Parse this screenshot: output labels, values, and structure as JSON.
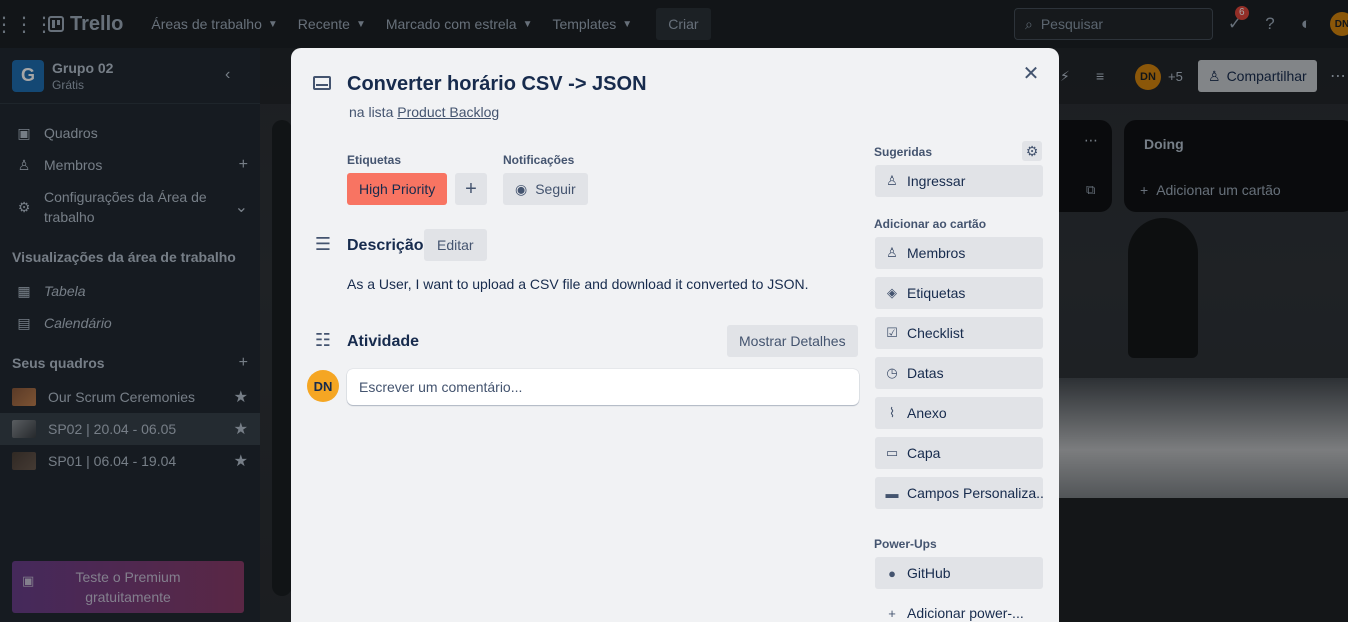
{
  "topbar": {
    "logo": "Trello",
    "nav": [
      "Áreas de trabalho",
      "Recente",
      "Marcado com estrela",
      "Templates"
    ],
    "create": "Criar",
    "search_placeholder": "Pesquisar",
    "notification_count": "6",
    "avatar": "DN"
  },
  "sidebar": {
    "workspace_initial": "G",
    "workspace_name": "Grupo 02",
    "workspace_plan": "Grátis",
    "items": [
      {
        "label": "Quadros",
        "icon": "trello-icon"
      },
      {
        "label": "Membros",
        "icon": "user-icon"
      },
      {
        "label": "Configurações da Área de trabalho",
        "icon": "gear-icon"
      }
    ],
    "views_title": "Visualizações da área de trabalho",
    "views": [
      {
        "label": "Tabela",
        "icon": "table-icon"
      },
      {
        "label": "Calendário",
        "icon": "calendar-icon"
      }
    ],
    "boards_title": "Seus quadros",
    "boards": [
      {
        "label": "Our Scrum Ceremonies",
        "color": "#8b5a3c"
      },
      {
        "label": "SP02 | 20.04 - 06.05",
        "color": "#5a6068"
      },
      {
        "label": "SP01 | 06.04 - 19.04",
        "color": "#4a4038"
      }
    ],
    "premium": "Teste o Premium gratuitamente"
  },
  "board": {
    "avatar": "DN",
    "extra_members": "+5",
    "share": "Compartilhar",
    "list_title": "Doing",
    "add_card": "Adicionar um cartão"
  },
  "card": {
    "title": "Converter horário CSV -> JSON",
    "in_list_prefix": "na lista",
    "list_name": "Product Backlog",
    "labels_title": "Etiquetas",
    "label": "High Priority",
    "label_color": "#f87462",
    "notifications_title": "Notificações",
    "follow": "Seguir",
    "description_title": "Descrição",
    "edit": "Editar",
    "description": "As a User, I want to upload a CSV file and download it converted to JSON.",
    "activity_title": "Atividade",
    "show_details": "Mostrar Detalhes",
    "commenter": "DN",
    "comment_placeholder": "Escrever um comentário..."
  },
  "side": {
    "suggested_title": "Sugeridas",
    "join": "Ingressar",
    "add_title": "Adicionar ao cartão",
    "actions": [
      {
        "label": "Membros",
        "icon": "user-icon"
      },
      {
        "label": "Etiquetas",
        "icon": "tag-icon"
      },
      {
        "label": "Checklist",
        "icon": "checklist-icon"
      },
      {
        "label": "Datas",
        "icon": "clock-icon"
      },
      {
        "label": "Anexo",
        "icon": "paperclip-icon"
      },
      {
        "label": "Capa",
        "icon": "cover-icon"
      },
      {
        "label": "Campos Personaliza...",
        "icon": "custom-fields-icon"
      }
    ],
    "powerups_title": "Power-Ups",
    "github": "GitHub",
    "add_powerup": "Adicionar power-..."
  }
}
